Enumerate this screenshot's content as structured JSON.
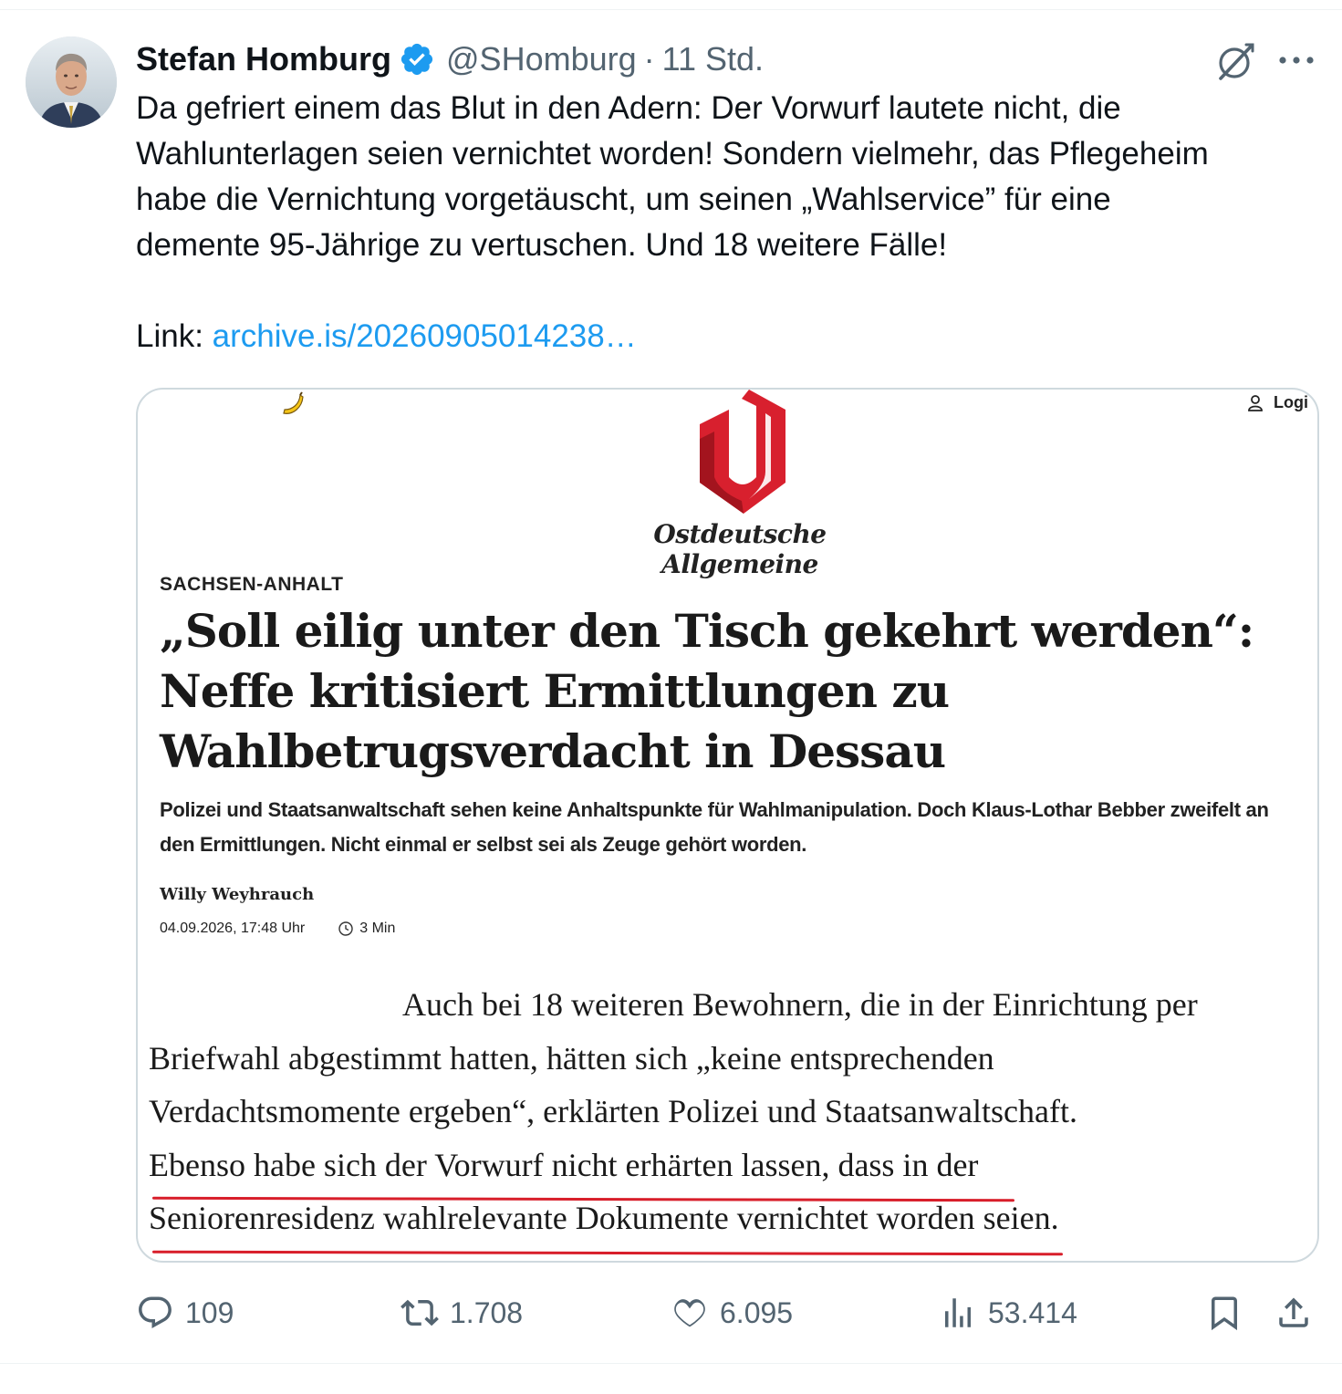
{
  "author": {
    "name": "Stefan Homburg",
    "handle": "@SHomburg",
    "separator": "·",
    "time": "11 Std."
  },
  "tweet": {
    "text": "Da gefriert einem das Blut in den Adern: Der Vorwurf lautete nicht, die\nWahlunterlagen seien vernichtet worden! Sondern vielmehr, das Pflegeheim\nhabe die Vernichtung vorgetäuscht, um seinen „Wahlservice” für eine\ndemente 95-Jährige zu vertuschen. Und 18 weitere Fälle!",
    "link_prefix": "Link: ",
    "link_url": "archive.is/20260905014238…"
  },
  "article": {
    "login_label": "Logi",
    "brand": "Ostdeutsche Allgemeine",
    "category": "SACHSEN-ANHALT",
    "headline": "„Soll eilig unter den Tisch gekehrt werden“: Neffe kritisiert Ermittlungen zu Wahlbetrugsverdacht in Dessau",
    "lead": "Polizei und Staatsanwaltschaft sehen keine Anhaltspunkte für Wahlmanipulation. Doch Klaus-Lothar Bebber zweifelt an den Ermittlungen. Nicht einmal er selbst sei als Zeuge gehört worden.",
    "author": "Willy Weyhrauch",
    "date": "04.09.2026, 17:48 Uhr",
    "read_time": "3 Min",
    "excerpt_lines": [
      "Auch bei 18 weiteren Bewohnern, die in der Einrichtung per",
      "Briefwahl abgestimmt hatten, hätten sich „keine entsprechenden",
      "Verdachtsmomente ergeben“, erklärten Polizei und Staatsanwaltschaft.",
      "Ebenso habe sich der Vorwurf nicht erhärten lassen, dass in der",
      "Seniorenresidenz wahlrelevante Dokumente vernichtet worden seien."
    ],
    "logo_color": "#d8202e",
    "underline_color": "#d81e2a"
  },
  "actions": {
    "replies": "109",
    "reposts": "1.708",
    "likes": "6.095",
    "views": "53.414"
  },
  "colors": {
    "link": "#1d9bf0",
    "verified": "#1d9bf0",
    "muted": "#536471",
    "text": "#0f1419"
  },
  "icons": [
    "verified-badge-icon",
    "grok-icon",
    "more-icon",
    "banana-icon",
    "user-icon",
    "clock-icon",
    "reply-icon",
    "retweet-icon",
    "like-icon",
    "views-icon",
    "bookmark-icon",
    "share-icon"
  ]
}
